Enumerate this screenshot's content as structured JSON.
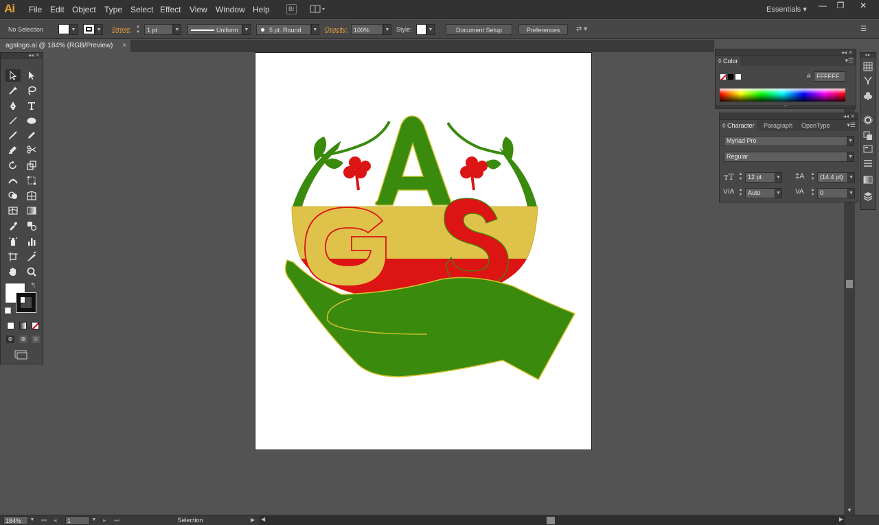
{
  "app": {
    "logo": "Ai"
  },
  "menu": [
    "File",
    "Edit",
    "Object",
    "Type",
    "Select",
    "Effect",
    "View",
    "Window",
    "Help"
  ],
  "menubar": {
    "bridge_icon": "Br",
    "workspace": "Essentials"
  },
  "window_controls": {
    "minimize": "—",
    "maximize": "❐",
    "close": "✕"
  },
  "control_bar": {
    "selection_status": "No Selection",
    "stroke_label": "Stroke:",
    "stroke_weight": "1 pt",
    "stroke_profile": "Uniform",
    "brush": "5 pt. Round",
    "opacity_label": "Opacity:",
    "opacity_value": "100%",
    "style_label": "Style:",
    "document_setup": "Document Setup",
    "preferences": "Preferences"
  },
  "document": {
    "tab_title": "agslogo.ai @ 184% (RGB/Preview)",
    "close": "×"
  },
  "color_panel": {
    "title": "Color",
    "hex_label": "#",
    "hex_value": "FFFFFF"
  },
  "character_panel": {
    "tabs": [
      "Character",
      "Paragraph",
      "OpenType"
    ],
    "font_family": "Myriad Pro",
    "font_style": "Regular",
    "font_size": "12 pt",
    "leading": "(14.4 pt)",
    "kerning": "Auto",
    "tracking": "0"
  },
  "status_bar": {
    "zoom": "184%",
    "page": "1",
    "tool": "Selection"
  },
  "artwork": {
    "letters": [
      "A",
      "G",
      "S"
    ],
    "colors": {
      "green": "#3a8a0e",
      "red": "#dc1414",
      "yellow": "#dfc24a",
      "outline": "#d4c22a"
    }
  },
  "theme": {
    "accent_orange": "#e89a3c",
    "workspace_bg": "#535353",
    "panel_bg": "#474747"
  }
}
